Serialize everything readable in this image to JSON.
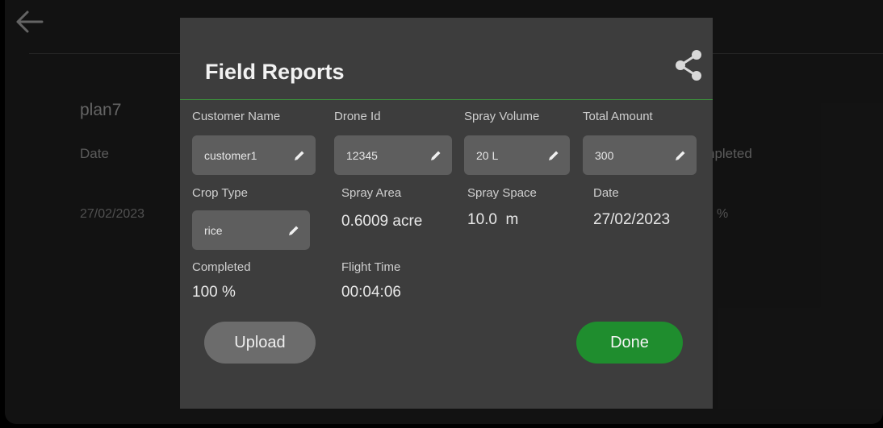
{
  "background": {
    "plan_name": "plan7",
    "date_label": "Date",
    "date_value": "27/02/2023",
    "completed_label_partial": "npleted",
    "percent_partial": "%"
  },
  "dialog": {
    "title": "Field Reports",
    "share_icon": "share-icon",
    "fields": {
      "customer_name": {
        "label": "Customer Name",
        "value": "customer1"
      },
      "drone_id": {
        "label": "Drone Id",
        "value": "12345"
      },
      "spray_volume": {
        "label": "Spray Volume",
        "value": "20 L"
      },
      "total_amount": {
        "label": "Total Amount",
        "value": "300"
      },
      "crop_type": {
        "label": "Crop Type",
        "value": "rice"
      },
      "spray_area": {
        "label": "Spray Area",
        "value": "0.6009 acre"
      },
      "spray_space": {
        "label": "Spray Space",
        "value": "10.0  m"
      },
      "date": {
        "label": "Date",
        "value": "27/02/2023"
      },
      "completed": {
        "label": "Completed",
        "value": "100 %"
      },
      "flight_time": {
        "label": "Flight Time",
        "value": "00:04:06"
      }
    },
    "buttons": {
      "upload": "Upload",
      "done": "Done"
    }
  },
  "colors": {
    "accent_green": "#1f8d2e",
    "dialog_bg": "#3d3d3d",
    "field_bg": "#5e5e5e"
  }
}
